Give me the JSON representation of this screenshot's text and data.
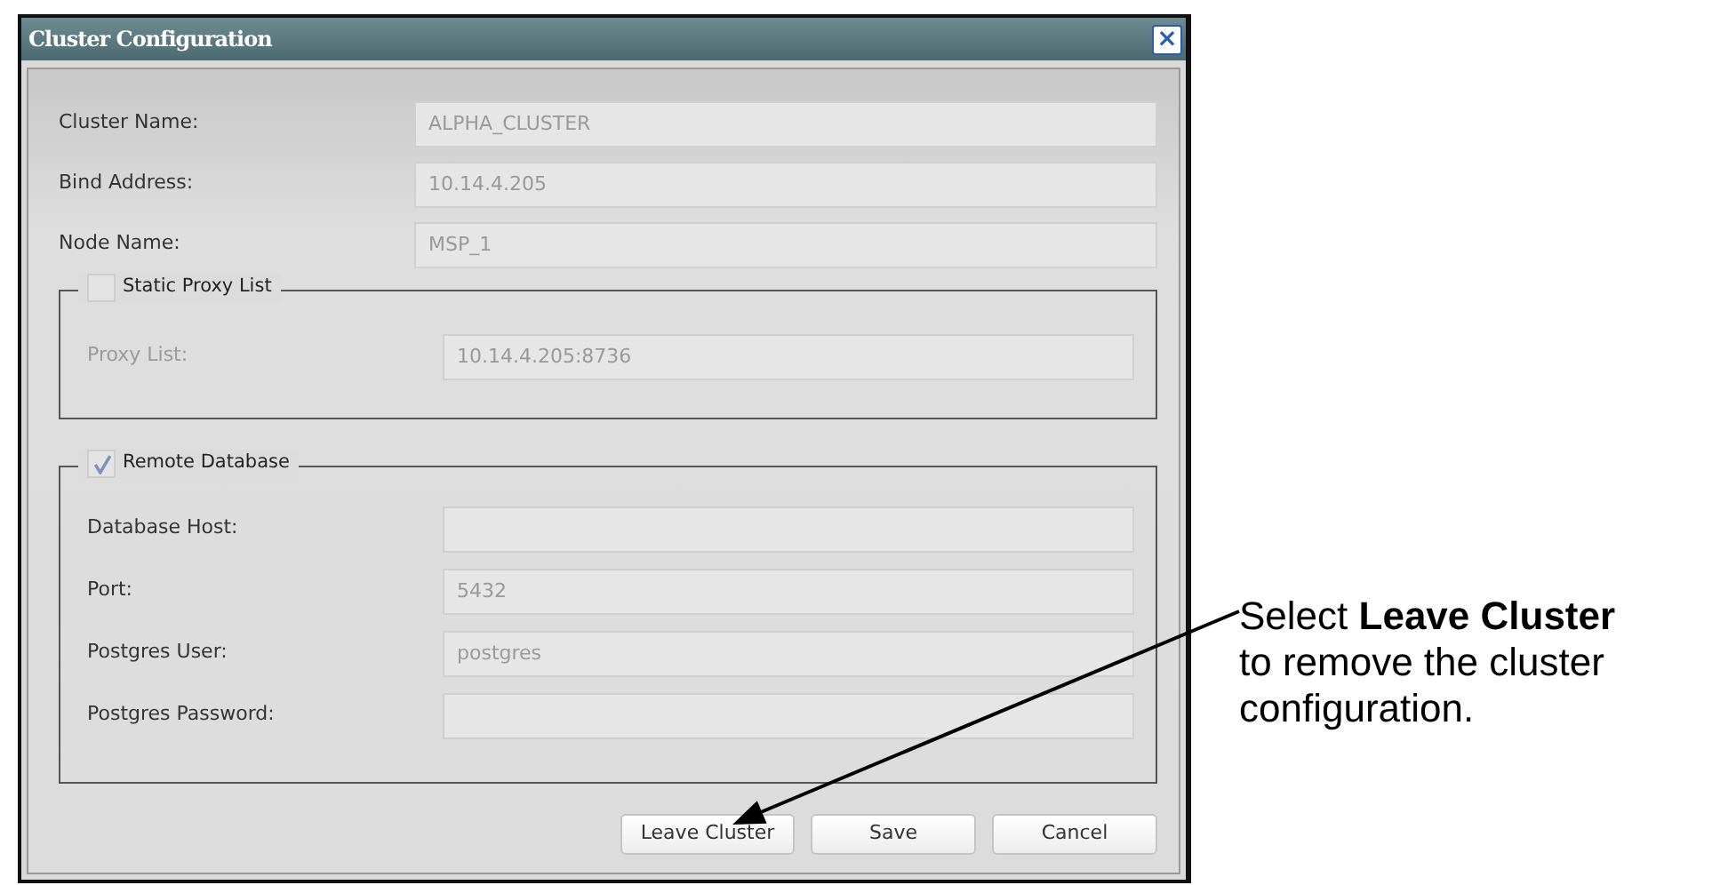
{
  "window": {
    "title": "Cluster Configuration",
    "close": "×"
  },
  "fields": [
    {
      "label": "Cluster Name:",
      "value": "ALPHA_CLUSTER"
    },
    {
      "label": "Bind Address:",
      "value": "10.14.4.205"
    },
    {
      "label": "Node Name:",
      "value": "MSP_1"
    }
  ],
  "groups": [
    {
      "label": "Static Proxy List",
      "checked": false,
      "fields": [
        {
          "label": "Proxy List:",
          "value": "10.14.4.205:8736"
        }
      ]
    },
    {
      "label": "Remote Database",
      "checked": true,
      "fields": [
        {
          "label": "Database Host:"
        },
        {
          "label": "Port:",
          "value": "5432"
        },
        {
          "label": "Postgres User:",
          "value": "postgres"
        },
        {
          "label": "Postgres Password:"
        }
      ]
    }
  ],
  "buttons": [
    "Leave Cluster",
    "Save",
    "Cancel"
  ],
  "callout": {
    "text": "Select **Leave Cluster** to remove the cluster configuration."
  }
}
